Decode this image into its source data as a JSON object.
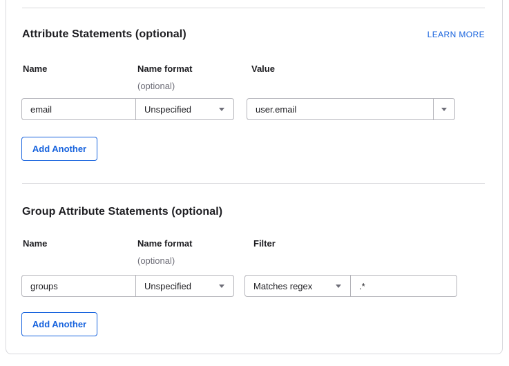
{
  "colors": {
    "accent_blue": "#1662dd",
    "text_dark": "#1d1d21",
    "text_muted": "#6e6e78",
    "card_border": "#d8d8dc",
    "input_border": "#b3b3b9"
  },
  "attribute_statements": {
    "heading": "Attribute Statements (optional)",
    "learn_more_label": "LEARN MORE",
    "col_name": "Name",
    "col_name_format": "Name format",
    "col_name_format_note": "(optional)",
    "col_value": "Value",
    "rows": [
      {
        "name": "email",
        "name_format": "Unspecified",
        "value": "user.email"
      }
    ],
    "add_button_label": "Add Another"
  },
  "group_attribute_statements": {
    "heading": "Group Attribute Statements (optional)",
    "col_name": "Name",
    "col_name_format": "Name format",
    "col_name_format_note": "(optional)",
    "col_filter": "Filter",
    "rows": [
      {
        "name": "groups",
        "name_format": "Unspecified",
        "filter_type": "Matches regex",
        "filter_value": ".*"
      }
    ],
    "add_button_label": "Add Another"
  }
}
